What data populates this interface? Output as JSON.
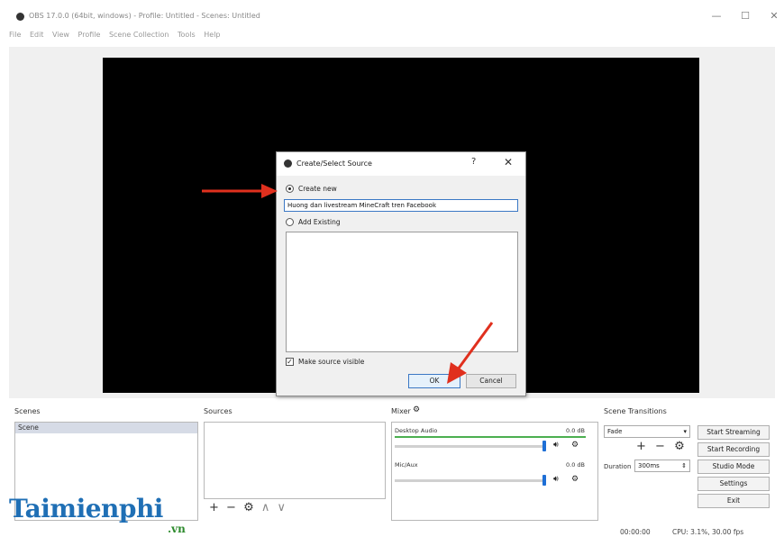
{
  "window": {
    "title": "OBS 17.0.0 (64bit, windows) - Profile: Untitled - Scenes: Untitled",
    "minimize": "—",
    "maximize": "☐",
    "close": "✕"
  },
  "menu": [
    "File",
    "Edit",
    "View",
    "Profile",
    "Scene Collection",
    "Tools",
    "Help"
  ],
  "dialog": {
    "title": "Create/Select Source",
    "help": "?",
    "close": "✕",
    "create_new_label": "Create new",
    "name_value": "Huong dan livestream MineCraft tren Facebook",
    "add_existing_label": "Add Existing",
    "visible_label": "Make source visible",
    "visible_check": "✓",
    "ok_label": "OK",
    "cancel_label": "Cancel"
  },
  "scenes": {
    "label": "Scenes",
    "items": [
      "Scene"
    ]
  },
  "sources": {
    "label": "Sources",
    "tools": [
      "+",
      "−",
      "⚙",
      "∧",
      "∨"
    ]
  },
  "mixer": {
    "label": "Mixer",
    "tracks": [
      {
        "name": "Desktop Audio",
        "db": "0.0 dB"
      },
      {
        "name": "Mic/Aux",
        "db": "0.0 dB"
      }
    ]
  },
  "transitions": {
    "label": "Scene Transitions",
    "selected": "Fade",
    "tools": [
      "+",
      "−",
      "⚙"
    ],
    "duration_label": "Duration",
    "duration_value": "300ms"
  },
  "controls": {
    "start_streaming": "Start Streaming",
    "start_recording": "Start Recording",
    "studio_mode": "Studio Mode",
    "settings": "Settings",
    "exit": "Exit"
  },
  "status": {
    "time": "00:00:00",
    "cpu": "CPU: 3.1%, 30.00 fps"
  },
  "watermark": {
    "main": "Taimienphi",
    "sub": ".vn"
  },
  "colors": {
    "accent": "#1e6fd6",
    "arrow": "#e0301e",
    "watermark": "#1f6fb5"
  }
}
